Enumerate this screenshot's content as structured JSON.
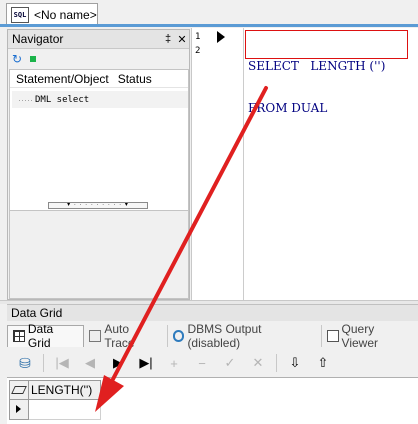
{
  "document_tab": {
    "icon": "SQL",
    "label": "<No name>"
  },
  "navigator": {
    "title": "Navigator",
    "pin_icon": "‡",
    "close_icon": "✕",
    "toolbar": {
      "refresh_icon": "↻"
    },
    "columns": [
      "Statement/Object",
      "Status"
    ],
    "items": [
      {
        "tree_prefix": "·····",
        "label": "DML select",
        "status": ""
      }
    ],
    "splitter_glyph": "▾ · · · · · · · · · ▾"
  },
  "editor": {
    "line_numbers": [
      "1",
      "2"
    ],
    "lines": [
      "SELECT   LENGTH ('')",
      "FROM DUAL"
    ],
    "highlight_color": "#dd1111",
    "text_color": "#000080"
  },
  "data_grid": {
    "title": "Data Grid",
    "tabs": [
      {
        "label": "Data Grid",
        "active": true
      },
      {
        "label": "Auto Trace",
        "active": false
      },
      {
        "label": "DBMS Output (disabled)",
        "active": false
      },
      {
        "label": "Query Viewer",
        "active": false
      }
    ],
    "toolbar": {
      "db_icon": "⛁",
      "first": "|◀",
      "prev": "◀",
      "next": "▶",
      "last": "▶|",
      "insert": "+",
      "delete": "−",
      "post": "✓",
      "cancel": "✕",
      "export": "⇩",
      "import": "⇧"
    },
    "columns": [
      "LENGTH('')"
    ],
    "rows": [
      [
        ""
      ]
    ]
  },
  "annotation": {
    "arrow_color": "#e02020"
  }
}
